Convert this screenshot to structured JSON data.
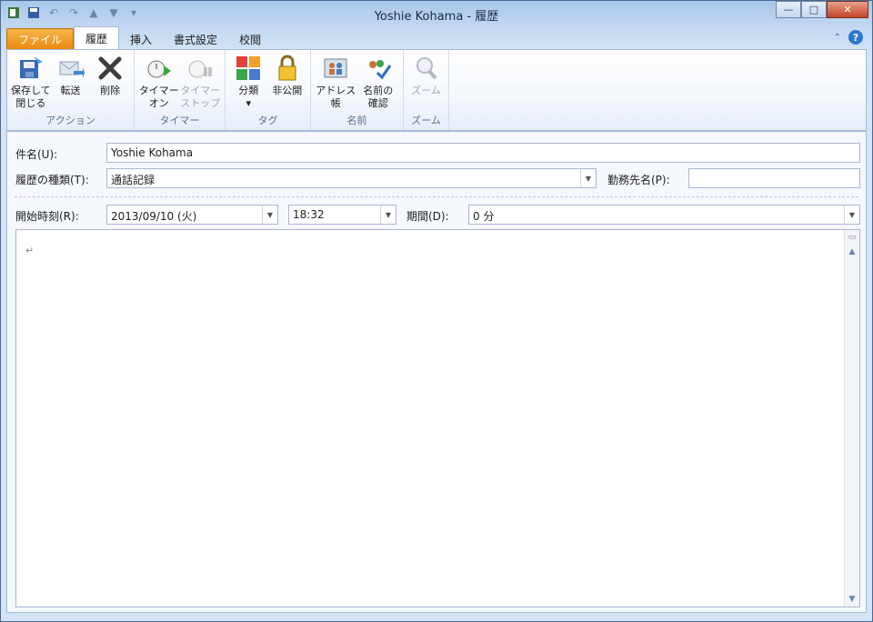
{
  "window": {
    "title": "Yoshie Kohama - 履歴",
    "buttons": {
      "minimize": "—",
      "maximize": "□",
      "close": "✕"
    }
  },
  "qat": {
    "icons": [
      "outlook-icon",
      "save-icon",
      "undo-icon",
      "redo-icon",
      "up-arrow-icon",
      "down-arrow-icon",
      "customize-icon"
    ]
  },
  "tabs": [
    "ファイル",
    "履歴",
    "挿入",
    "書式設定",
    "校閲"
  ],
  "ribbon": {
    "groups": [
      {
        "label": "アクション",
        "buttons": [
          {
            "label": "保存して\n閉じる",
            "icon": "save-close-icon"
          },
          {
            "label": "転送",
            "icon": "forward-icon"
          },
          {
            "label": "削除",
            "icon": "delete-icon"
          }
        ]
      },
      {
        "label": "タイマー",
        "buttons": [
          {
            "label": "タイマー\nオン",
            "icon": "timer-on-icon"
          },
          {
            "label": "タイマー\nストップ",
            "icon": "timer-stop-icon",
            "disabled": true
          }
        ]
      },
      {
        "label": "タグ",
        "buttons": [
          {
            "label": "分類\n▾",
            "icon": "categorize-icon"
          },
          {
            "label": "非公開",
            "icon": "lock-icon"
          }
        ]
      },
      {
        "label": "名前",
        "buttons": [
          {
            "label": "アドレス帳",
            "icon": "address-book-icon"
          },
          {
            "label": "名前の\n確認",
            "icon": "check-names-icon"
          }
        ]
      },
      {
        "label": "ズーム",
        "buttons": [
          {
            "label": "ズーム",
            "icon": "zoom-icon",
            "disabled": true
          }
        ]
      }
    ]
  },
  "form": {
    "subject_label": "件名(U):",
    "subject_value": "Yoshie Kohama",
    "type_label": "履歴の種類(T):",
    "type_value": "通話記録",
    "company_label": "勤務先名(P):",
    "company_value": "",
    "start_label": "開始時刻(R):",
    "start_date": "2013/09/10 (火)",
    "start_time": "18:32",
    "duration_label": "期間(D):",
    "duration_value": "0 分",
    "body_mark": "↵"
  }
}
